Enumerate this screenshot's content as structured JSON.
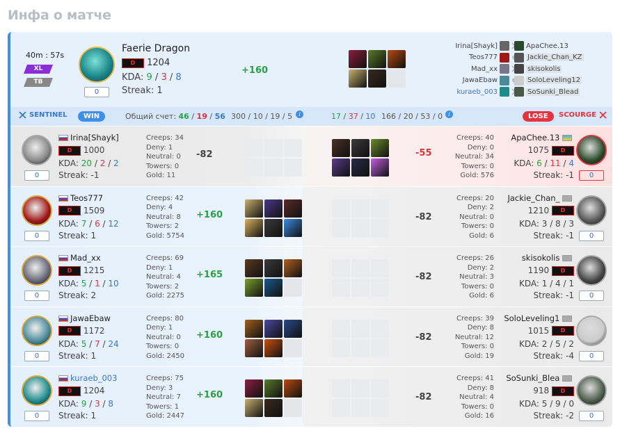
{
  "page_title": "Инфа о матче",
  "summary": {
    "duration": "40m : 57s",
    "chips": [
      "XL",
      "TB"
    ],
    "hero_name": "Faerie Dragon",
    "rank": "D",
    "mmr": "1204",
    "kda_label": "KDA:",
    "kills": "9",
    "deaths": "3",
    "assists": "8",
    "streak_label": "Streak:",
    "streak": "1",
    "level": "0",
    "delta": "+160",
    "items": [
      {
        "color": "#8b1f3f"
      },
      {
        "color": "#5a7a2a"
      },
      {
        "color": "#b84a10"
      },
      {
        "color": "#c8b070"
      },
      {
        "color": "#3a2a20"
      },
      {
        "color": "empty"
      }
    ],
    "sentinel_players": [
      "Irina[Shayk]",
      "Teos777",
      "Mad_xx",
      "JawaEbaw",
      "kuraeb_003"
    ],
    "scourge_players": [
      "ApaChee.13",
      "Jackie_Chan_KZ",
      "skisokolis",
      "SoloLeveling12",
      "SoSunki_Blead"
    ]
  },
  "team_bar": {
    "sentinel": "SENTINEL",
    "win": "WIN",
    "score_label": "Общий счет:",
    "kills": "46",
    "deaths": "19",
    "assists": "56",
    "sentinel_totals": "300 / 10 / 19 / 5",
    "s_k": "17",
    "s_d": "37",
    "s_a": "10",
    "scourge_totals": "166 / 20 / 53 / 0",
    "lose": "LOSE",
    "scourge": "SCOURGE"
  },
  "rows": [
    {
      "left": {
        "name": "Irina[Shayk]",
        "rank": "D",
        "mmr": "1000",
        "kda_label": "KDA:",
        "k": "20",
        "d": "2",
        "a": "2",
        "streak": "Streak: -1",
        "level": "0",
        "creeps": "Creeps: 34",
        "deny": "Deny: 1",
        "neutral": "Neutral: 0",
        "towers": "Towers: 0",
        "gold": "Gold: 11",
        "delta": "-82",
        "color": "#888"
      },
      "right": {
        "name": "ApaChee.13",
        "rank": "D",
        "mmr": "1075",
        "kda_label": "KDA:",
        "k": "6",
        "d": "11",
        "a": "4",
        "streak": "Streak: -1",
        "level": "0",
        "creeps": "Creeps: 40",
        "deny": "Deny: 0",
        "neutral": "Neutral: 34",
        "towers": "Towers: 0",
        "gold": "Gold: 576",
        "delta": "-55",
        "color": "#2a4a2a"
      }
    },
    {
      "left": {
        "name": "Teos777",
        "rank": "D",
        "mmr": "1509",
        "kda_label": "KDA:",
        "k": "7",
        "d": "6",
        "a": "12",
        "streak": "Streak: 1",
        "level": "0",
        "creeps": "Creeps: 42",
        "deny": "Deny: 4",
        "neutral": "Neutral: 8",
        "towers": "Towers: 2",
        "gold": "Gold: 5754",
        "delta": "+160",
        "color": "#a01818"
      },
      "right": {
        "name": "Jackie_Chan_",
        "rank": "D",
        "mmr": "1210",
        "kda_label": "KDA:",
        "k": "3",
        "d": "8",
        "a": "3",
        "streak": "Streak: -1",
        "level": "0",
        "creeps": "Creeps: 20",
        "deny": "Deny: 2",
        "neutral": "Neutral: 0",
        "towers": "Towers: 0",
        "gold": "Gold: 6",
        "delta": "-82",
        "color": "#555"
      }
    },
    {
      "left": {
        "name": "Mad_xx",
        "rank": "D",
        "mmr": "1215",
        "kda_label": "KDA:",
        "k": "5",
        "d": "1",
        "a": "10",
        "streak": "Streak: 2",
        "level": "0",
        "creeps": "Creeps: 69",
        "deny": "Deny: 1",
        "neutral": "Neutral: 4",
        "towers": "Towers: 2",
        "gold": "Gold: 2275",
        "delta": "+165",
        "color": "#667"
      },
      "right": {
        "name": "skisokolis",
        "rank": "D",
        "mmr": "1190",
        "kda_label": "KDA:",
        "k": "1",
        "d": "4",
        "a": "1",
        "streak": "Streak: -1",
        "level": "0",
        "creeps": "Creeps: 26",
        "deny": "Deny: 2",
        "neutral": "Neutral: 3",
        "towers": "Towers: 0",
        "gold": "Gold: 6",
        "delta": "-82",
        "color": "#444"
      }
    },
    {
      "left": {
        "name": "JawaEbaw",
        "rank": "D",
        "mmr": "1172",
        "kda_label": "KDA:",
        "k": "5",
        "d": "7",
        "a": "24",
        "streak": "Streak: 1",
        "level": "0",
        "creeps": "Creeps: 80",
        "deny": "Deny: 1",
        "neutral": "Neutral: 0",
        "towers": "Towers: 0",
        "gold": "Gold: 2450",
        "delta": "+160",
        "color": "#4a8a9a"
      },
      "right": {
        "name": "SoloLeveling1",
        "rank": "D",
        "mmr": "1015",
        "kda_label": "KDA:",
        "k": "2",
        "d": "5",
        "a": "2",
        "streak": "Streak: -4",
        "level": "0",
        "creeps": "Creeps: 39",
        "deny": "Deny: 8",
        "neutral": "Neutral: 12",
        "towers": "Towers: 0",
        "gold": "Gold: 19",
        "delta": "-82",
        "color": "#ccc"
      }
    },
    {
      "left": {
        "name": "kuraeb_003",
        "rank": "D",
        "mmr": "1204",
        "kda_label": "KDA:",
        "k": "9",
        "d": "3",
        "a": "8",
        "streak": "Streak: 1",
        "level": "0",
        "creeps": "Creeps: 75",
        "deny": "Deny: 3",
        "neutral": "Neutral: 7",
        "towers": "Towers: 1",
        "gold": "Gold: 2447",
        "delta": "+160",
        "color": "#1d8a8c"
      },
      "right": {
        "name": "SoSunki_Blea",
        "rank": "D",
        "mmr": "918",
        "kda_label": "KDA:",
        "k": "5",
        "d": "9",
        "a": "0",
        "streak": "Streak: -2",
        "level": "0",
        "creeps": "Creeps: 41",
        "deny": "Deny: 8",
        "neutral": "Neutral: 4",
        "towers": "Towers: 0",
        "gold": "Gold: 16",
        "delta": "-82",
        "color": "#4a5a4a"
      }
    }
  ],
  "row_items": [
    [
      {
        "color": "#4a3028"
      },
      {
        "color": "#3a3a3a"
      },
      {
        "color": "#6a8a2a"
      },
      {
        "color": "#5a3a8a"
      },
      {
        "color": "#2a2a4a"
      },
      {
        "color": "#c060e0"
      }
    ],
    [
      {
        "color": "#c8b070"
      },
      {
        "color": "#4a3a8a"
      },
      {
        "color": "#5a2a2a"
      },
      {
        "color": "#d8b060"
      },
      {
        "color": "#3a3a3a"
      },
      {
        "color": "#3a8ae0"
      }
    ],
    [
      {
        "color": "#5a3a20"
      },
      {
        "color": "#3a3a3a"
      },
      {
        "color": "#b06020"
      },
      {
        "color": "#7aa030"
      },
      {
        "color": "#1a5a8a"
      },
      {
        "color": "empty"
      }
    ],
    [
      {
        "color": "#a06020"
      },
      {
        "color": "#4a4aa0"
      },
      {
        "color": "#2a4a8a"
      },
      {
        "color": "#a06040"
      },
      {
        "color": "#c85010"
      },
      {
        "color": "empty"
      }
    ],
    [
      {
        "color": "#8b1f3f"
      },
      {
        "color": "#5a7a2a"
      },
      {
        "color": "#b84a10"
      },
      {
        "color": "#c8b070"
      },
      {
        "color": "#3a2a20"
      },
      {
        "color": "empty"
      }
    ]
  ],
  "colors": {
    "accent": "#3f8fe6",
    "win": "#3f8fe6",
    "lose": "#e5333f",
    "kills": "#2aa044",
    "deaths": "#d8343f",
    "assists": "#3a78c8"
  }
}
